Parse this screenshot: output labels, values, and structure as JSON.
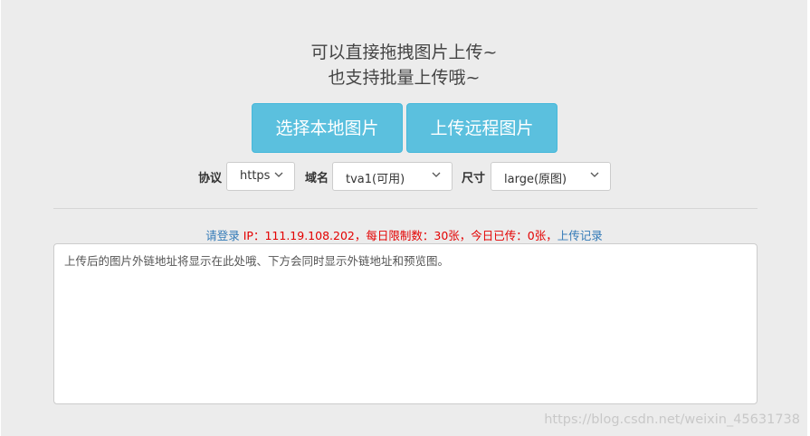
{
  "header": {
    "line1": "可以直接拖拽图片上传~",
    "line2": "也支持批量上传哦~"
  },
  "buttons": {
    "local_upload": "选择本地图片",
    "remote_upload": "上传远程图片"
  },
  "options": {
    "protocol": {
      "label": "协议",
      "value": "https"
    },
    "domain": {
      "label": "域名",
      "value": "tva1(可用)"
    },
    "size": {
      "label": "尺寸",
      "value": "large(原图)"
    }
  },
  "status": {
    "login_link": "请登录",
    "info": " IP：111.19.108.202，每日限制数：30张，今日已传：0张，",
    "history_link": "上传记录"
  },
  "textarea": {
    "placeholder": "上传后的图片外链地址将显示在此处哦、下方会同时显示外链地址和预览图。"
  },
  "watermark": "https://blog.csdn.net/weixin_45631738",
  "colors": {
    "button_bg": "#5bc0de",
    "status_red": "#e30000",
    "link_blue": "#337ab7",
    "panel_bg": "#ececec"
  }
}
